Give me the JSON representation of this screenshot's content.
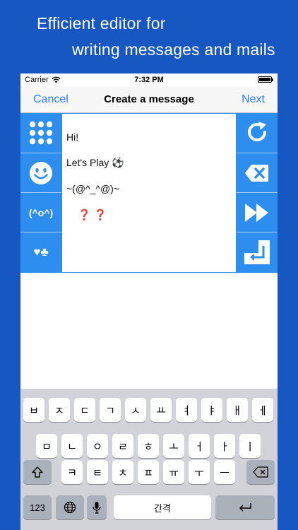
{
  "headline": {
    "line1": "Efficient editor for",
    "line2": "writing messages and mails"
  },
  "status": {
    "carrier": "Carrier",
    "time": "7:32 PM"
  },
  "nav": {
    "left": "Cancel",
    "title": "Create a message",
    "right": "Next"
  },
  "left_tools": [
    {
      "icon": "grid-icon"
    },
    {
      "icon": "smiley-icon"
    },
    {
      "icon": "emoticon-icon",
      "label": "(^o^)"
    },
    {
      "icon": "card-suits-icon",
      "label": "♥♣"
    }
  ],
  "right_tools": [
    {
      "icon": "refresh-icon"
    },
    {
      "icon": "delete-icon"
    },
    {
      "icon": "fast-forward-icon"
    },
    {
      "icon": "return-icon"
    }
  ],
  "editor": {
    "lines": [
      "Hi!",
      "Let's Play ⚽",
      "~(@^_^@)~",
      "❓ ❓"
    ]
  },
  "keyboard": {
    "row1": [
      "ㅂ",
      "ㅈ",
      "ㄷ",
      "ㄱ",
      "ㅅ",
      "ㅛ",
      "ㅕ",
      "ㅑ",
      "ㅐ",
      "ㅔ"
    ],
    "row2": [
      "ㅁ",
      "ㄴ",
      "ㅇ",
      "ㄹ",
      "ㅎ",
      "ㅗ",
      "ㅓ",
      "ㅏ",
      "ㅣ"
    ],
    "row3": [
      "ㅋ",
      "ㅌ",
      "ㅊ",
      "ㅍ",
      "ㅠ",
      "ㅜ",
      "ㅡ"
    ],
    "numbers_label": "123",
    "space_label": "간격",
    "shift_icon": "shift-icon",
    "backspace_icon": "backspace-icon",
    "globe_icon": "globe-icon",
    "mic_icon": "mic-icon",
    "return_icon": "return-key-icon"
  },
  "colors": {
    "background": "#1657c1",
    "toolbar": "#2d8ef0",
    "link": "#2c7cf6",
    "keyboard": "#d1d3d9"
  }
}
